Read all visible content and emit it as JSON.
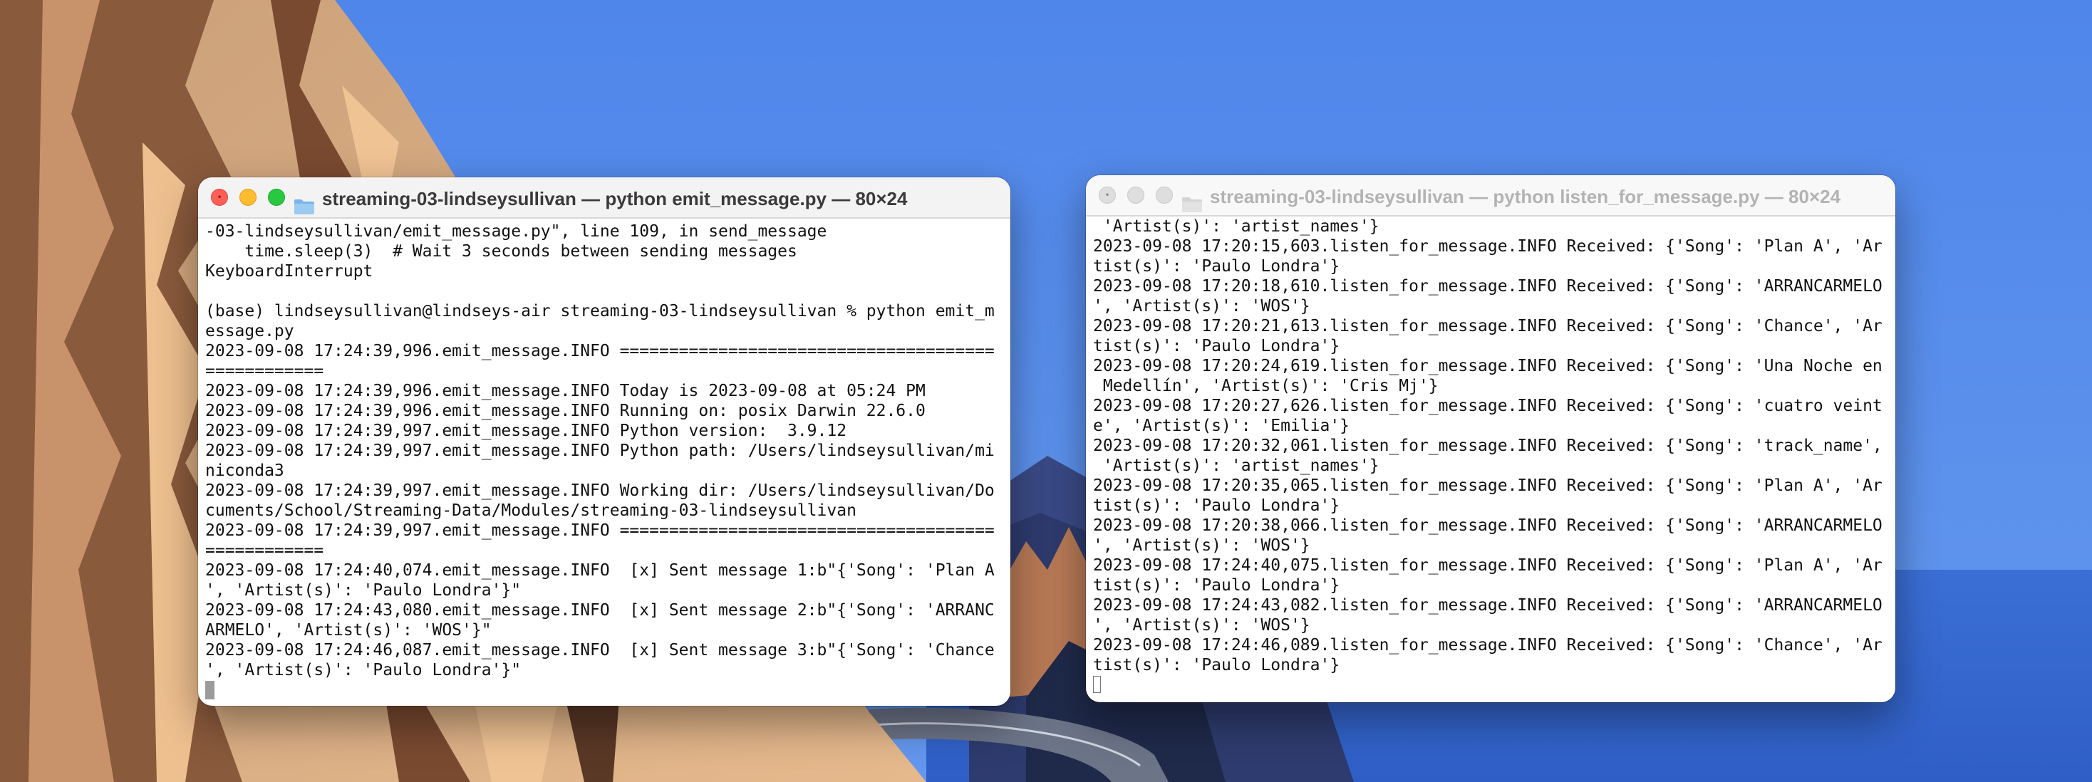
{
  "colors": {
    "sky": "#5b8fe6",
    "sea": "#3f6ed2",
    "cliff_light": "#d9a77a",
    "cliff_dark": "#6b4630",
    "terminal_bg": "#ffffff",
    "text": "#111111"
  },
  "left_window": {
    "title": "streaming-03-lindseysullivan — python emit_message.py — 80×24",
    "title_icon": "folder-icon",
    "lines": [
      "-03-lindseysullivan/emit_message.py\", line 109, in send_message",
      "    time.sleep(3)  # Wait 3 seconds between sending messages",
      "KeyboardInterrupt",
      "",
      "(base) lindseysullivan@lindseys-air streaming-03-lindseysullivan % python emit_m",
      "essage.py",
      "2023-09-08 17:24:39,996.emit_message.INFO ======================================",
      "============",
      "2023-09-08 17:24:39,996.emit_message.INFO Today is 2023-09-08 at 05:24 PM",
      "2023-09-08 17:24:39,996.emit_message.INFO Running on: posix Darwin 22.6.0",
      "2023-09-08 17:24:39,997.emit_message.INFO Python version:  3.9.12",
      "2023-09-08 17:24:39,997.emit_message.INFO Python path: /Users/lindseysullivan/mi",
      "niconda3",
      "2023-09-08 17:24:39,997.emit_message.INFO Working dir: /Users/lindseysullivan/Do",
      "cuments/School/Streaming-Data/Modules/streaming-03-lindseysullivan",
      "2023-09-08 17:24:39,997.emit_message.INFO ======================================",
      "============",
      "2023-09-08 17:24:40,074.emit_message.INFO  [x] Sent message 1:b\"{'Song': 'Plan A",
      "', 'Artist(s)': 'Paulo Londra'}\"",
      "2023-09-08 17:24:43,080.emit_message.INFO  [x] Sent message 2:b\"{'Song': 'ARRANC",
      "ARMELO', 'Artist(s)': 'WOS'}\"",
      "2023-09-08 17:24:46,087.emit_message.INFO  [x] Sent message 3:b\"{'Song': 'Chance",
      "', 'Artist(s)': 'Paulo Londra'}\""
    ]
  },
  "right_window": {
    "title": "streaming-03-lindseysullivan — python listen_for_message.py — 80×24",
    "title_icon": "folder-icon",
    "lines": [
      " 'Artist(s)': 'artist_names'}",
      "2023-09-08 17:20:15,603.listen_for_message.INFO Received: {'Song': 'Plan A', 'Ar",
      "tist(s)': 'Paulo Londra'}",
      "2023-09-08 17:20:18,610.listen_for_message.INFO Received: {'Song': 'ARRANCARMELO",
      "', 'Artist(s)': 'WOS'}",
      "2023-09-08 17:20:21,613.listen_for_message.INFO Received: {'Song': 'Chance', 'Ar",
      "tist(s)': 'Paulo Londra'}",
      "2023-09-08 17:20:24,619.listen_for_message.INFO Received: {'Song': 'Una Noche en",
      " Medellín', 'Artist(s)': 'Cris Mj'}",
      "2023-09-08 17:20:27,626.listen_for_message.INFO Received: {'Song': 'cuatro veint",
      "e', 'Artist(s)': 'Emilia'}",
      "2023-09-08 17:20:32,061.listen_for_message.INFO Received: {'Song': 'track_name',",
      " 'Artist(s)': 'artist_names'}",
      "2023-09-08 17:20:35,065.listen_for_message.INFO Received: {'Song': 'Plan A', 'Ar",
      "tist(s)': 'Paulo Londra'}",
      "2023-09-08 17:20:38,066.listen_for_message.INFO Received: {'Song': 'ARRANCARMELO",
      "', 'Artist(s)': 'WOS'}",
      "2023-09-08 17:24:40,075.listen_for_message.INFO Received: {'Song': 'Plan A', 'Ar",
      "tist(s)': 'Paulo Londra'}",
      "2023-09-08 17:24:43,082.listen_for_message.INFO Received: {'Song': 'ARRANCARMELO",
      "', 'Artist(s)': 'WOS'}",
      "2023-09-08 17:24:46,089.listen_for_message.INFO Received: {'Song': 'Chance', 'Ar",
      "tist(s)': 'Paulo Londra'}"
    ]
  }
}
